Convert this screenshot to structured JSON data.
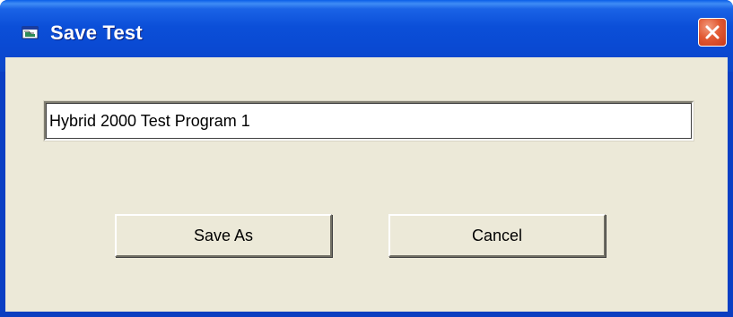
{
  "window": {
    "title": "Save Test",
    "icon": "window-app-icon",
    "close_icon": "close-x-icon",
    "titlebar_color": "#0b4fd8",
    "close_color": "#e25a33",
    "background_color": "#ece9d8"
  },
  "form": {
    "name_value": "Hybrid 2000 Test Program 1"
  },
  "buttons": {
    "save_as_label": "Save As",
    "cancel_label": "Cancel"
  }
}
